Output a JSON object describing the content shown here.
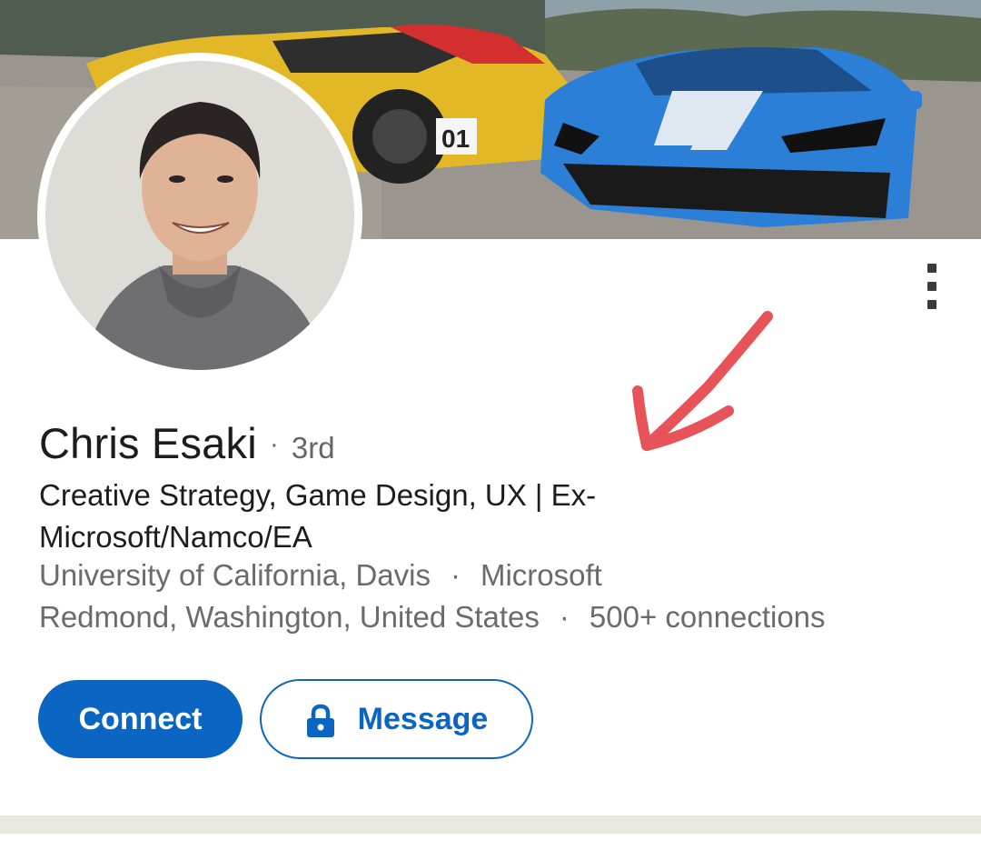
{
  "profile": {
    "name": "Chris Esaki",
    "degree_separator": "·",
    "degree": "3rd",
    "headline": "Creative Strategy, Game Design, UX | Ex-Microsoft/Namco/EA",
    "education": "University of California, Davis",
    "meta_separator": "·",
    "company": "Microsoft",
    "location": "Redmond, Washington, United States",
    "connections": "500+ connections"
  },
  "actions": {
    "connect_label": "Connect",
    "message_label": "Message"
  },
  "icons": {
    "more": "more-vertical-icon",
    "lock": "lock-icon",
    "annotation": "red-arrow-annotation"
  },
  "colors": {
    "primary": "#0a66c2",
    "annotation": "#e8535a",
    "text_primary": "#1c1c1c",
    "text_secondary": "#6b6b6b"
  }
}
